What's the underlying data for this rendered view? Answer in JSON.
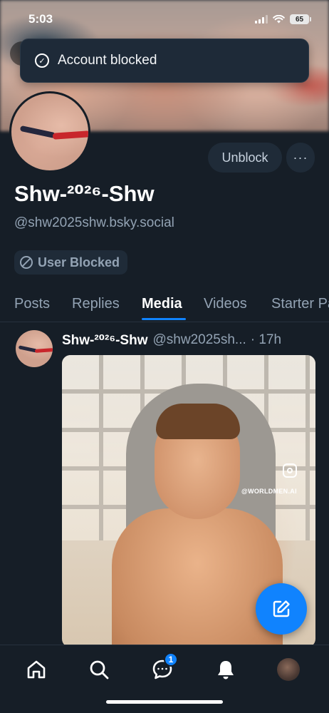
{
  "status_bar": {
    "time": "5:03",
    "battery": "65"
  },
  "toast": {
    "message": "Account blocked",
    "icon": "check-circle-icon"
  },
  "profile": {
    "display_name": "Shw-²⁰²⁶-Shw",
    "handle": "@shw2025shw.bsky.social",
    "unblock_label": "Unblock",
    "more_label": "···",
    "blocked_badge": "User Blocked"
  },
  "tabs": [
    {
      "label": "Posts",
      "active": false
    },
    {
      "label": "Replies",
      "active": false
    },
    {
      "label": "Media",
      "active": true
    },
    {
      "label": "Videos",
      "active": false
    },
    {
      "label": "Starter Packs",
      "active": false
    }
  ],
  "post": {
    "author_name": "Shw-²⁰²⁶-Shw",
    "author_handle": "@shw2025sh...",
    "time": "· 17h",
    "image_watermark": "@WORLDMEN.AI"
  },
  "bottom_nav": {
    "items": [
      "home-icon",
      "search-icon",
      "chat-icon",
      "bell-icon",
      "avatar"
    ],
    "chat_badge": "1"
  },
  "colors": {
    "background": "#161e27",
    "accent": "#1083fe",
    "muted_text": "#93a3b4",
    "button_bg": "#1f2b38"
  }
}
